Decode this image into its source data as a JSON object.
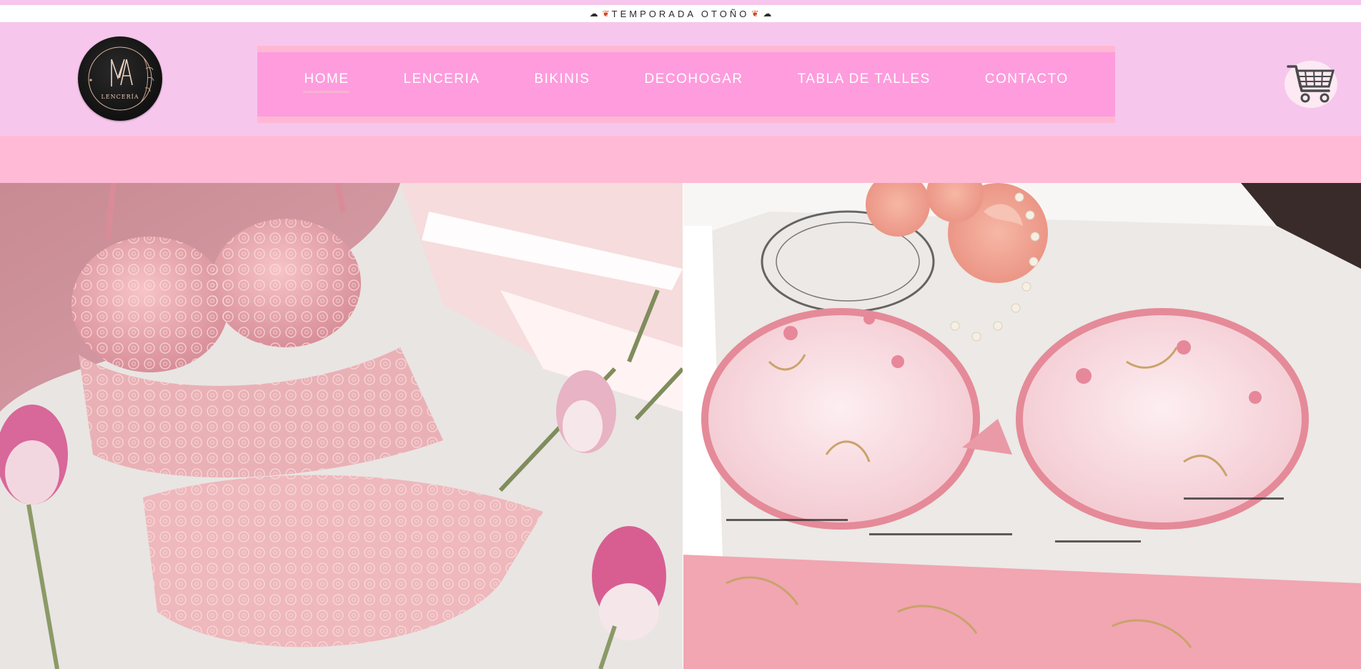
{
  "announcement": {
    "text": "TEMPORADA OTOÑO",
    "icons": [
      "cloud-icon",
      "leaf-icon",
      "leaf-icon",
      "cloud-icon"
    ]
  },
  "logo": {
    "text": "LENCERÍA",
    "icon": "logo-emblem"
  },
  "nav": {
    "items": [
      {
        "label": "HOME",
        "active": true
      },
      {
        "label": "LENCERIA"
      },
      {
        "label": "BIKINIS"
      },
      {
        "label": "DECOHOGAR"
      },
      {
        "label": "TABLA DE TALLES"
      },
      {
        "label": "CONTACTO"
      }
    ]
  },
  "cart": {
    "icon": "cart-icon"
  },
  "hero": {
    "images": [
      "pink-lace-lingerie-photo",
      "embroidered-bra-tray-photo"
    ]
  },
  "colors": {
    "header_bg": "#f7c6ec",
    "nav_bg": "#fe9cdd",
    "nav_border": "#ffb8d4",
    "band_bg": "#ffbad5",
    "text_light": "#ffffff"
  }
}
